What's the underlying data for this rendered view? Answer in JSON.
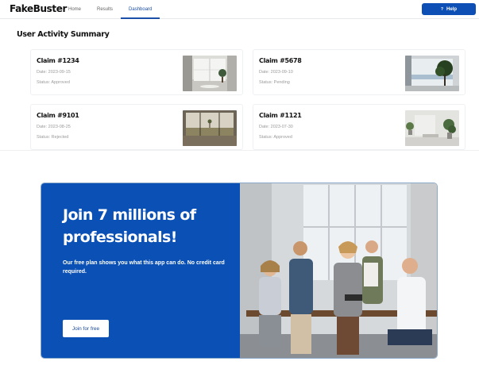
{
  "app": {
    "brand": "FakeBuster"
  },
  "nav": {
    "items": [
      {
        "label": "Home"
      },
      {
        "label": "Results"
      },
      {
        "label": "Dashboard"
      }
    ],
    "help_label": "Help",
    "help_icon": "?"
  },
  "section": {
    "title": "User Activity Summary"
  },
  "claims": [
    {
      "title": "Claim #1234",
      "date": "Date: 2023-09-15",
      "status": "Status: Approved",
      "thumb": "bright-room-with-window-and-tree"
    },
    {
      "title": "Claim #5678",
      "date": "Date: 2023-09-10",
      "status": "Status: Pending",
      "thumb": "window-view-with-tree"
    },
    {
      "title": "Claim #9101",
      "date": "Date: 2023-08-25",
      "status": "Status: Rejected",
      "thumb": "room-with-field-view"
    },
    {
      "title": "Claim #1121",
      "date": "Date: 2023-07-30",
      "status": "Status: Approved",
      "thumb": "grey-room-with-plants"
    }
  ],
  "promo": {
    "heading": "Join 7 millions of professionals!",
    "text": "Our free plan shows you what this app can do. No credit card required.",
    "cta": "Join for free",
    "image": "team-of-professionals-photo"
  },
  "colors": {
    "accent": "#0b50b5",
    "nav_active": "#1c4fa8"
  }
}
